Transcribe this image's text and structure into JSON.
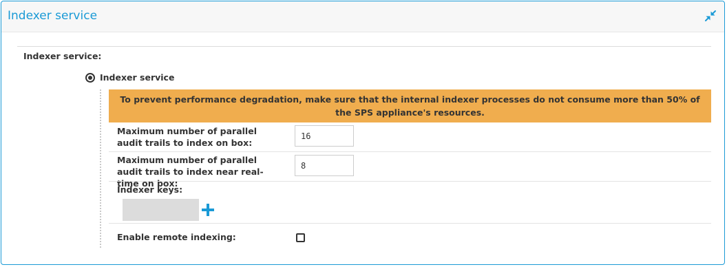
{
  "panel": {
    "title": "Indexer service",
    "collapse_icon": "collapse-arrows-icon"
  },
  "section": {
    "label": "Indexer service:"
  },
  "radio": {
    "label": "Indexer service",
    "selected": true
  },
  "warning": {
    "text": "To prevent performance degradation, make sure that the internal indexer processes do not consume more than 50% of the SPS appliance's resources.",
    "color": "#f0ad4e"
  },
  "fields": {
    "parallel_on_box": {
      "label": "Maximum number of parallel audit trails to index on box:",
      "value": "16"
    },
    "parallel_realtime": {
      "label": "Maximum number of parallel audit trails to index near real-time on box:",
      "value": "8"
    },
    "indexer_keys": {
      "label": "Indexer keys:",
      "add_icon": "plus-icon"
    },
    "remote_indexing": {
      "label": "Enable remote indexing:",
      "checked": false
    }
  },
  "colors": {
    "accent": "#1a9ad6",
    "warning": "#f0ad4e",
    "text": "#333333"
  }
}
